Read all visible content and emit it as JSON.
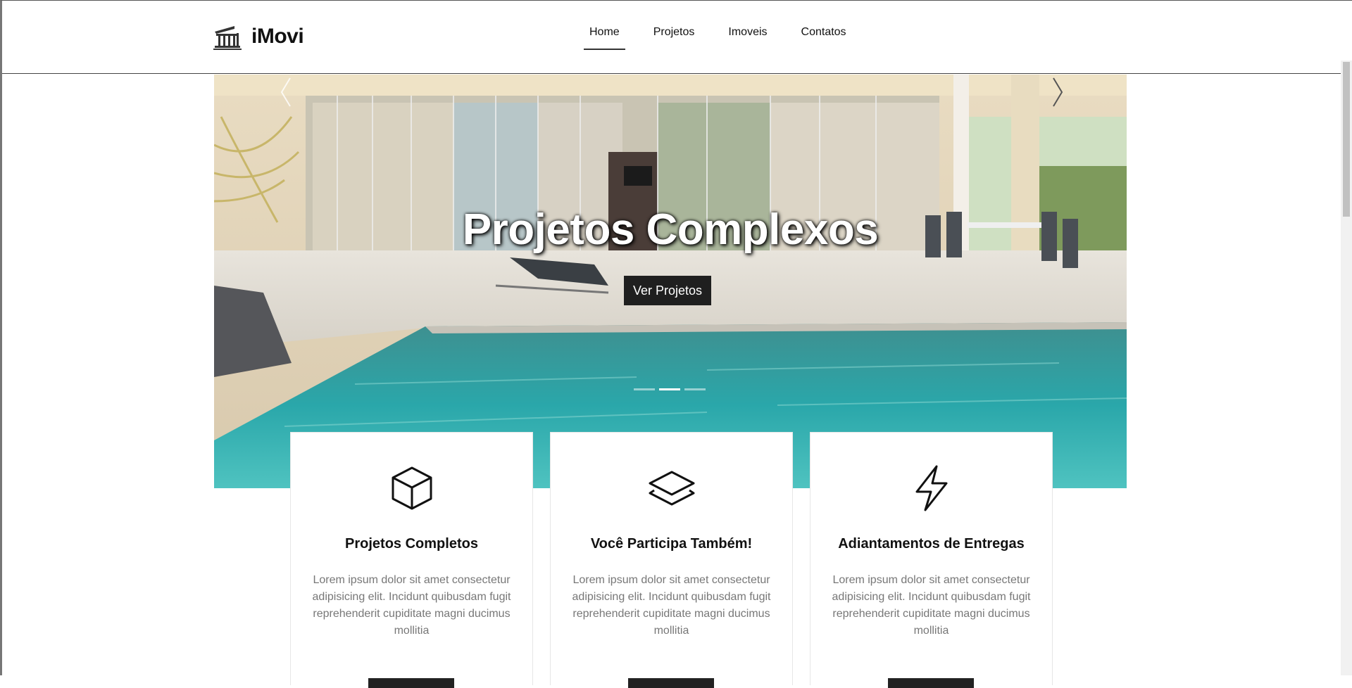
{
  "brand": {
    "name": "iMovi",
    "icon": "building-icon"
  },
  "nav": {
    "items": [
      {
        "label": "Home",
        "active": true
      },
      {
        "label": "Projetos",
        "active": false
      },
      {
        "label": "Imoveis",
        "active": false
      },
      {
        "label": "Contatos",
        "active": false
      }
    ]
  },
  "hero": {
    "title": "Projetos Complexos",
    "button_label": "Ver Projetos",
    "slide_count": 3,
    "active_slide": 2
  },
  "cards": [
    {
      "icon": "box-icon",
      "title": "Projetos Completos",
      "text": "Lorem ipsum dolor sit amet consectetur adipisicing elit. Incidunt quibusdam fugit reprehenderit cupiditate magni ducimus mollitia"
    },
    {
      "icon": "layers-icon",
      "title": "Você Participa Também!",
      "text": "Lorem ipsum dolor sit amet consectetur adipisicing elit. Incidunt quibusdam fugit reprehenderit cupiditate magni ducimus mollitia"
    },
    {
      "icon": "lightning-icon",
      "title": "Adiantamentos de Entregas",
      "text": "Lorem ipsum dolor sit amet consectetur adipisicing elit. Incidunt quibusdam fugit reprehenderit cupiditate magni ducimus mollitia"
    }
  ],
  "colors": {
    "dark_button": "#1f1f1f",
    "pool": "#2fa3a6",
    "text_muted": "#777777"
  }
}
